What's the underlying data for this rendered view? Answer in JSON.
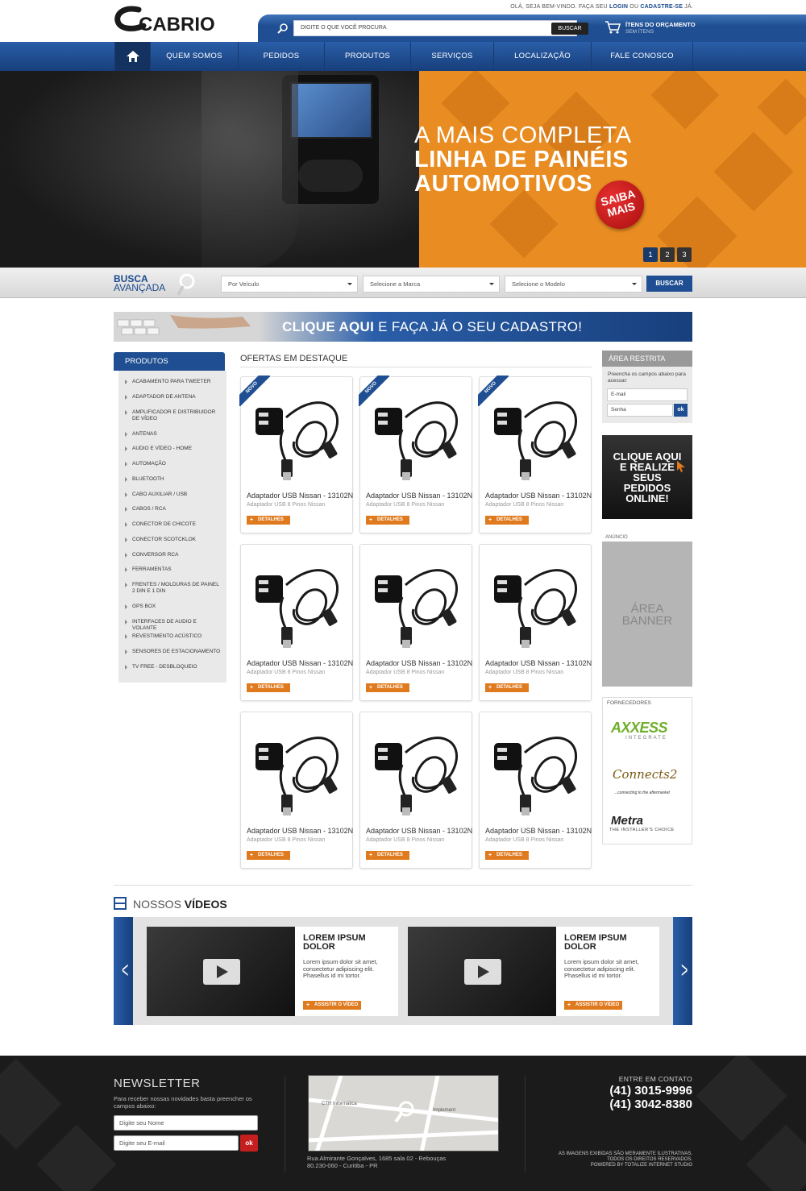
{
  "header": {
    "logo_text": "CABRIO",
    "welcome_prefix": "OLÁ, SEJA BEM-VINDO. FAÇA SEU",
    "login": "LOGIN",
    "or": "OU",
    "signup": "CADASTRE-SE",
    "suffix": "JÁ.",
    "search_placeholder": "DIGITE O QUE VOCÊ PROCURA",
    "search_button": "BUSCAR",
    "cart_title": "ÍTENS DO ORÇAMENTO",
    "cart_sub": "SEM ÍTENS"
  },
  "nav": {
    "items": [
      "QUEM SOMOS",
      "PEDIDOS",
      "PRODUTOS",
      "SERVIÇOS",
      "LOCALIZAÇÃO",
      "FALE CONOSCO"
    ]
  },
  "hero": {
    "line1": "A MAIS COMPLETA",
    "line2": "LINHA DE PAINÉIS",
    "line3": "AUTOMOTIVOS",
    "badge_line1": "SAIBA",
    "badge_line2": "MAIS",
    "pages": [
      "1",
      "2",
      "3"
    ],
    "active_page": "1",
    "accent": "#e98d22"
  },
  "busca": {
    "title1": "BUSCA",
    "title2": "AVANÇADA",
    "select1": "Por Veículo",
    "select2": "Selecione a Marca",
    "select3": "Selecione o Modelo",
    "button": "BUSCAR"
  },
  "cadastro_banner": {
    "bold": "CLIQUE AQUI",
    "rest": "E FAÇA JÁ O SEU CADASTRO!"
  },
  "sidebar": {
    "title": "PRODUTOS",
    "items": [
      "ACABAMENTO PARA TWEETER",
      "ADAPTADOR DE ANTENA",
      "AMPLIFICADOR E DISTRIBUIDOR DE VÍDEO",
      "ANTENAS",
      "AUDIO E VÍDEO - HOME",
      "AUTOMAÇÃO",
      "BLUETOOTH",
      "CABO AUXILIAR / USB",
      "CABOS / RCA",
      "CONECTOR DE CHICOTE",
      "CONECTOR SCOTCKLOK",
      "CONVERSOR RCA",
      "FERRAMENTAS",
      "FRENTES / MOLDURAS DE PAINEL 2 DIN E 1 DIN",
      "GPS BOX",
      "INTERFACES DE AUDIO E VOLANTE",
      "REVESTIMENTO ACÚSTICO",
      "SENSORES DE ESTACIONAMENTO",
      "TV FREE - DESBLOQUEIO"
    ]
  },
  "ofertas": {
    "title": "OFERTAS EM DESTAQUE",
    "novo_label": "NOVO",
    "details_label": "DETALHES",
    "products": [
      {
        "name": "Adaptador USB Nissan - 13102N",
        "sub": "Adaptador USB 8 Pinos Nissan"
      },
      {
        "name": "Adaptador USB Nissan - 13102N",
        "sub": "Adaptador USB 8 Pinos Nissan"
      },
      {
        "name": "Adaptador USB Nissan - 13102N",
        "sub": "Adaptador USB 8 Pinos Nissan"
      },
      {
        "name": "Adaptador USB Nissan - 13102N",
        "sub": "Adaptador USB 8 Pinos Nissan"
      },
      {
        "name": "Adaptador USB Nissan - 13102N",
        "sub": "Adaptador USB 8 Pinos Nissan"
      },
      {
        "name": "Adaptador USB Nissan - 13102N",
        "sub": "Adaptador USB 8 Pinos Nissan"
      },
      {
        "name": "Adaptador USB Nissan - 13102N",
        "sub": "Adaptador USB 8 Pinos Nissan"
      },
      {
        "name": "Adaptador USB Nissan - 13102N",
        "sub": "Adaptador USB 8 Pinos Nissan"
      },
      {
        "name": "Adaptador USB Nissan - 13102N",
        "sub": "Adaptador USB 8 Pinos Nissan"
      }
    ]
  },
  "area_restrita": {
    "title": "ÁREA RESTRITA",
    "desc": "Preencha os campos abaixo para acessar:",
    "email": "E-mail",
    "senha": "Senha",
    "ok": "ok"
  },
  "pedidos_banner": {
    "lines": [
      "CLIQUE AQUI",
      "E REALIZE",
      "SEUS",
      "PEDIDOS",
      "ONLINE!"
    ]
  },
  "anuncio": {
    "label": "ANÚNCIO",
    "line1": "ÁREA",
    "line2": "BANNER"
  },
  "fornecedores": {
    "title": "FORNECEDORES",
    "logos": [
      "AXXESS",
      "INTEGRATE",
      "Connects2",
      "...connecting to the aftermarket",
      "Metra",
      "THE INSTALLER'S CHOICE"
    ]
  },
  "videos": {
    "title_light": "NOSSOS",
    "title_bold": "VÍDEOS",
    "items": [
      {
        "title": "LOREM IPSUM DOLOR",
        "desc": "Lorem ipsum dolor sit amet, consectetur adipiscing elit. Phasellus id mi tortor.",
        "button": "ASSISTIR O VÍDEO"
      },
      {
        "title": "LOREM IPSUM DOLOR",
        "desc": "Lorem ipsum dolor sit amet, consectetur adipiscing elit. Phasellus id mi tortor.",
        "button": "ASSISTIR O VÍDEO"
      }
    ]
  },
  "footer": {
    "newsletter_title": "NEWSLETTER",
    "newsletter_desc": "Para receber nossas novidades basta preencher os campos abaixo:",
    "name_placeholder": "Digite seu Nome",
    "email_placeholder": "Digite seu E-mail",
    "ok": "ok",
    "map_label1": "CTR Informática",
    "map_label2": "Implement",
    "address1": "Rua Almirante Gonçalves, 1685 sala 02 - Rebouças",
    "address2": "80.230-060 - Curitiba - PR",
    "contact_title": "ENTRE EM CONTATO",
    "phone1": "(41) 3015-9996",
    "phone2": "(41) 3042-8380",
    "disclaimer1": "AS IMAGENS EXIBIDAS SÃO MERAMENTE ILUSTRATIVAS.",
    "disclaimer2": "TODOS OS DIREITOS RESERVADOS.",
    "disclaimer3": "POWERED BY TOTALIZE INTERNET STUDIO"
  }
}
